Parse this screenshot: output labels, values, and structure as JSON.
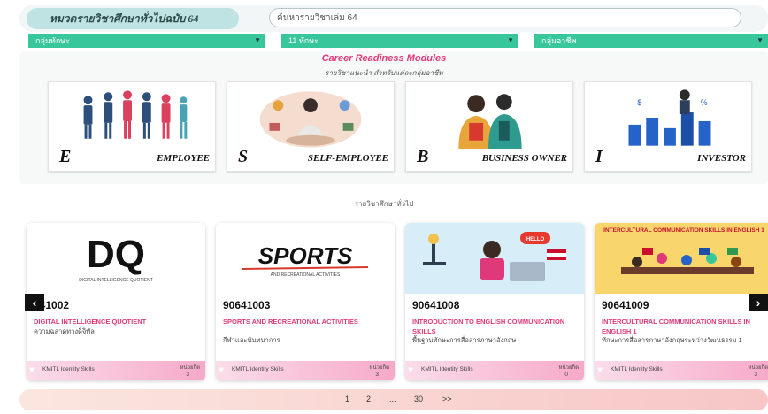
{
  "header": {
    "category_label": "หมวดรายวิชาศึกษาทั่วไปฉบับ 64",
    "search_value": "ค้นหารายวิชาเล่ม 64"
  },
  "filters": [
    {
      "label": "กลุ่มทักษะ"
    },
    {
      "label": "11 ทักษะ"
    },
    {
      "label": "กลุ่มอาชีพ"
    }
  ],
  "modules": {
    "title": "Career Readiness Modules",
    "subtitle": "รายวิชาแนะนำ สำหรับแต่ละกลุ่มอาชีพ",
    "items": [
      {
        "letter": "E",
        "label": "EMPLOYEE"
      },
      {
        "letter": "S",
        "label": "SELF-EMPLOYEE"
      },
      {
        "letter": "B",
        "label": "BUSINESS OWNER"
      },
      {
        "letter": "I",
        "label": "INVESTOR"
      }
    ]
  },
  "section_label": "รายวิชาศึกษาทั่วไป",
  "courses": [
    {
      "code": "641002",
      "thumb_text": "DQ",
      "thumb_caption": "DIGITAL INTELLIGENCE QUOTIENT",
      "title": "DIGITAL INTELLIGENCE QUOTIENT",
      "desc": "ความฉลาดทางดิจิทัล",
      "tag": "KMITL Identity Skills",
      "count_label": "หน่วยกิต",
      "count": "3"
    },
    {
      "code": "90641003",
      "thumb_text": "SPORTS",
      "thumb_caption": "AND RECREATIONAL ACTIVITIES",
      "title": "SPORTS AND RECREATIONAL ACTIVITIES",
      "desc": "กีฬาและนันทนาการ",
      "tag": "KMITL Identity Skills",
      "count_label": "หน่วยกิต",
      "count": "3"
    },
    {
      "code": "90641008",
      "thumb_text": "HELLO",
      "thumb_caption": "",
      "title": "INTRODUCTION TO ENGLISH COMMUNICATION SKILLS",
      "desc": "พื้นฐานทักษะการสื่อสารภาษาอังกฤษ",
      "tag": "KMITL Identity Skills",
      "count_label": "หน่วยกิต",
      "count": "0"
    },
    {
      "code": "90641009",
      "thumb_text": "INTERCULTURAL COMMUNICATION SKILLS IN ENGLISH 1",
      "thumb_caption": "",
      "title": "INTERCULTURAL COMMUNICATION SKILLS IN ENGLISH 1",
      "desc": "ทักษะการสื่อสารภาษาอังกฤษระหว่างวัฒนธรรม 1",
      "tag": "KMITL Identity Skills",
      "count_label": "หน่วยกิต",
      "count": "3"
    }
  ],
  "pagination": {
    "pages": [
      "1",
      "2",
      "...",
      "30",
      ">>"
    ]
  },
  "colors": {
    "accent_green": "#37c79a",
    "title_pink": "#e0397a",
    "pill_teal": "#bfe3e3"
  }
}
